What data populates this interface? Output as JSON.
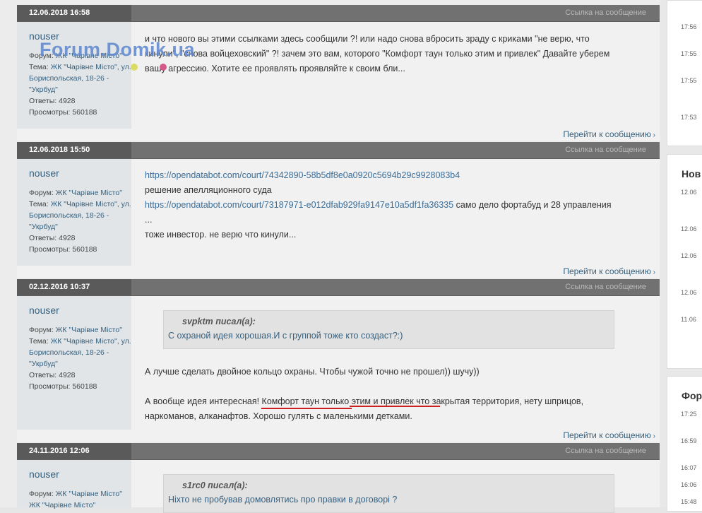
{
  "link_label": "Ссылка на сообщение",
  "goto_label": "Перейти к сообщению",
  "watermark": "Forum.Domik.ua",
  "posts": [
    {
      "date": "12.06.2018 16:58",
      "user": {
        "name": "nouser",
        "forum_label": "Форум:",
        "forum": "ЖК \"Чарівне Місто\"",
        "topic_label": "Тема:",
        "topic": "ЖК \"Чарівне Місто\", ул. Бориспольская, 18-26 - \"Укрбуд\"",
        "replies_label": "Ответы:",
        "replies": "4928",
        "views_label": "Просмотры:",
        "views": "560188"
      },
      "lines": [
        "и что нового вы этими ссылками здесь сообщили ?! или надо снова вбросить зраду с криками \"не верю, что",
        "кинули\", \"снова войцеховский\" ?! зачем это вам, которого \"Комфорт таун только этим и привлек\" Давайте уберем",
        "вашу агрессию. Хотите ее проявлять проявляйте к своим бли..."
      ]
    },
    {
      "date": "12.06.2018 15:50",
      "user": {
        "name": "nouser",
        "forum_label": "Форум:",
        "forum": "ЖК \"Чарівне Місто\"",
        "topic_label": "Тема:",
        "topic": "ЖК \"Чарівне Місто\", ул. Бориспольская, 18-26 - \"Укрбуд\"",
        "replies_label": "Ответы:",
        "replies": "4928",
        "views_label": "Просмотры:",
        "views": "560188"
      },
      "link1": "https://opendatabot.com/court/74342890-58b5df8e0a0920c5694b29c9928083b4",
      "text1": "решение апелляционного суда",
      "link2": "https://opendatabot.com/court/73187971-e012dfab929fa9147e10a5df1fa36335",
      "text2": " само дело фортабуд и 28 управления",
      "text3": "...",
      "text4": "тоже инвестор. не верю что кинули..."
    },
    {
      "date": "02.12.2016 10:37",
      "user": {
        "name": "nouser",
        "forum_label": "Форум:",
        "forum": "ЖК \"Чарівне Місто\"",
        "topic_label": "Тема:",
        "topic": "ЖК \"Чарівне Місто\", ул. Бориспольская, 18-26 - \"Укрбуд\"",
        "replies_label": "Ответы:",
        "replies": "4928",
        "views_label": "Просмотры:",
        "views": "560188"
      },
      "quote_author": "svpktm писал(а):",
      "quote_text": "С охраной идея хорошая.И с группой тоже кто создаст?:)",
      "p1": "А лучше сделать двойное кольцо охраны. Чтобы чужой точно не прошел)) шучу))",
      "p2a": "А вообще идея интересная! Комфорт таун только этим и привлек что закрытая территория, нету шприцов,",
      "p2b": "наркоманов, алканафтов. Хорошо гулять с маленькими детками."
    },
    {
      "date": "24.11.2016 12:06",
      "user": {
        "name": "nouser",
        "forum_label": "Форум:",
        "forum": "ЖК \"Чарівне Місто\"",
        "topic": "ЖК \"Чарівне Місто\""
      },
      "quote_author": "s1rc0 писал(а):",
      "quote_text": "Ніхто не пробував домовлятись про правки в договорі ?"
    }
  ],
  "sidebar": {
    "times_top": [
      "17:56",
      "17:55",
      "17:55",
      "17:53"
    ],
    "box2_title": "Нов",
    "box2_times": [
      "12.06",
      "12.06",
      "12.06",
      "12.06",
      "11.06"
    ],
    "box3_title": "Фор",
    "box3_times": [
      "17:25",
      "16:59",
      "16:07",
      "16:06",
      "15:48"
    ]
  }
}
